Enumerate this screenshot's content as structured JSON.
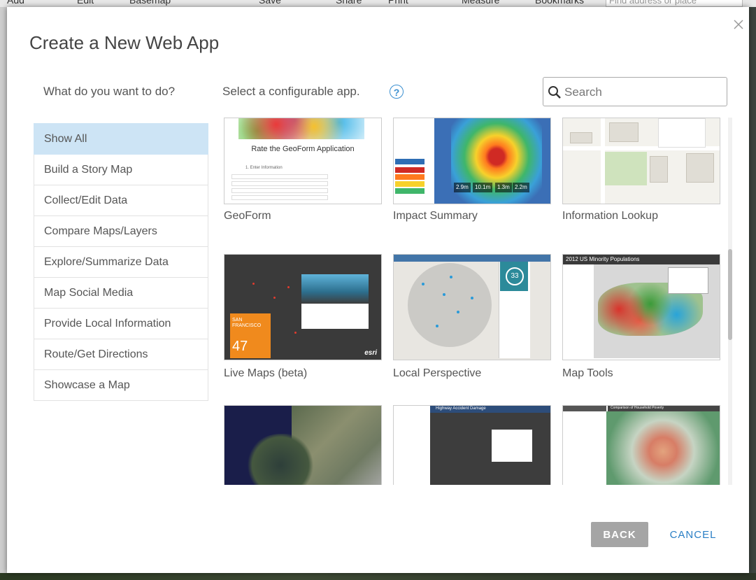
{
  "background": {
    "toolbar_items": [
      "Add",
      "Edit",
      "Basemap",
      "Save",
      "Share",
      "Print",
      "Measure",
      "Bookmarks"
    ],
    "search_placeholder": "Find address or place"
  },
  "dialog": {
    "title": "Create a New Web App",
    "close_icon": "close-icon",
    "prompt_left": "What do you want to do?",
    "prompt_right": "Select a configurable app.",
    "help_icon": "?",
    "search": {
      "placeholder": "Search",
      "value": ""
    },
    "categories": [
      {
        "label": "Show All",
        "active": true
      },
      {
        "label": "Build a Story Map",
        "active": false
      },
      {
        "label": "Collect/Edit Data",
        "active": false
      },
      {
        "label": "Compare Maps/Layers",
        "active": false
      },
      {
        "label": "Explore/Summarize Data",
        "active": false
      },
      {
        "label": "Map Social Media",
        "active": false
      },
      {
        "label": "Provide Local Information",
        "active": false
      },
      {
        "label": "Route/Get Directions",
        "active": false
      },
      {
        "label": "Showcase a Map",
        "active": false
      }
    ],
    "apps": [
      {
        "label": "GeoForm",
        "thumb_title": "Rate the GeoForm Application",
        "thumb_field": "1. Enter Information"
      },
      {
        "label": "Impact Summary",
        "stats": [
          "2.9m",
          "10.1m",
          "1.3m",
          "2.2m"
        ]
      },
      {
        "label": "Information Lookup"
      },
      {
        "label": "Live Maps (beta)",
        "thumb_city": "SAN FRANCISCO",
        "thumb_count": "47",
        "thumb_brand": "esri"
      },
      {
        "label": "Local Perspective",
        "thumb_badge": "33"
      },
      {
        "label": "Map Tools",
        "thumb_title": "2012 US Minority Populations"
      },
      {
        "label": ""
      },
      {
        "label": "",
        "thumb_title": "Highway Accident Damage"
      },
      {
        "label": "",
        "thumb_title": "Comparison of Household Poverty"
      }
    ],
    "buttons": {
      "back": "BACK",
      "cancel": "CANCEL"
    },
    "colors": {
      "accent": "#2a7fc5",
      "active_category": "#cde4f5",
      "back_button": "#a5a5a5"
    }
  }
}
